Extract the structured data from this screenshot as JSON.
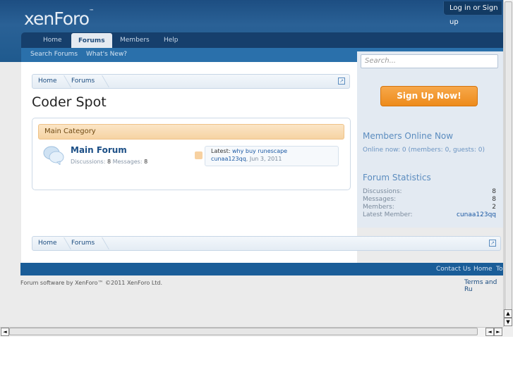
{
  "header": {
    "logo": "xenForo",
    "logo_tm": "™",
    "login": "Log in or Sign up"
  },
  "nav": {
    "tabs": [
      "Home",
      "Forums",
      "Members",
      "Help"
    ],
    "active_tab": "Forums",
    "sub_links": [
      "Search Forums",
      "What's New?"
    ]
  },
  "breadcrumb": {
    "items": [
      "Home",
      "Forums"
    ]
  },
  "page": {
    "title": "Coder Spot"
  },
  "category": {
    "name": "Main Category"
  },
  "forum": {
    "name": "Main Forum",
    "discussions_label": "Discussions:",
    "discussions_value": "8",
    "messages_label": "Messages:",
    "messages_value": "8",
    "latest_label": "Latest:",
    "latest_thread": "why buy runescape",
    "latest_user": "cunaa123qq",
    "latest_date": ", Jun 3, 2011"
  },
  "sidebar": {
    "search_placeholder": "Search...",
    "signup_label": "Sign Up Now!",
    "members_online_title": "Members Online Now",
    "members_online_text": "Online now: 0 (members: 0, guests: 0)",
    "stats_title": "Forum Statistics",
    "stats": [
      {
        "label": "Discussions:",
        "value": "8"
      },
      {
        "label": "Messages:",
        "value": "8"
      },
      {
        "label": "Members:",
        "value": "2"
      },
      {
        "label": "Latest Member:",
        "value": "cunaa123qq"
      }
    ]
  },
  "footer": {
    "links": [
      "Contact Us",
      "Home",
      "To"
    ],
    "copyright": "Forum software by XenForo™ ©2011 XenForo Ltd.",
    "terms": "Terms and Ru"
  },
  "colors": {
    "header_blue": "#1f5a8e",
    "signup_orange": "#ed8b1c",
    "link_blue": "#1a58a3",
    "category_bg": "#f6d3a3"
  },
  "scrollbars": {
    "left_arrow": "◄",
    "right_arrow": "►",
    "up_arrow": "▲",
    "down_arrow": "▼"
  }
}
